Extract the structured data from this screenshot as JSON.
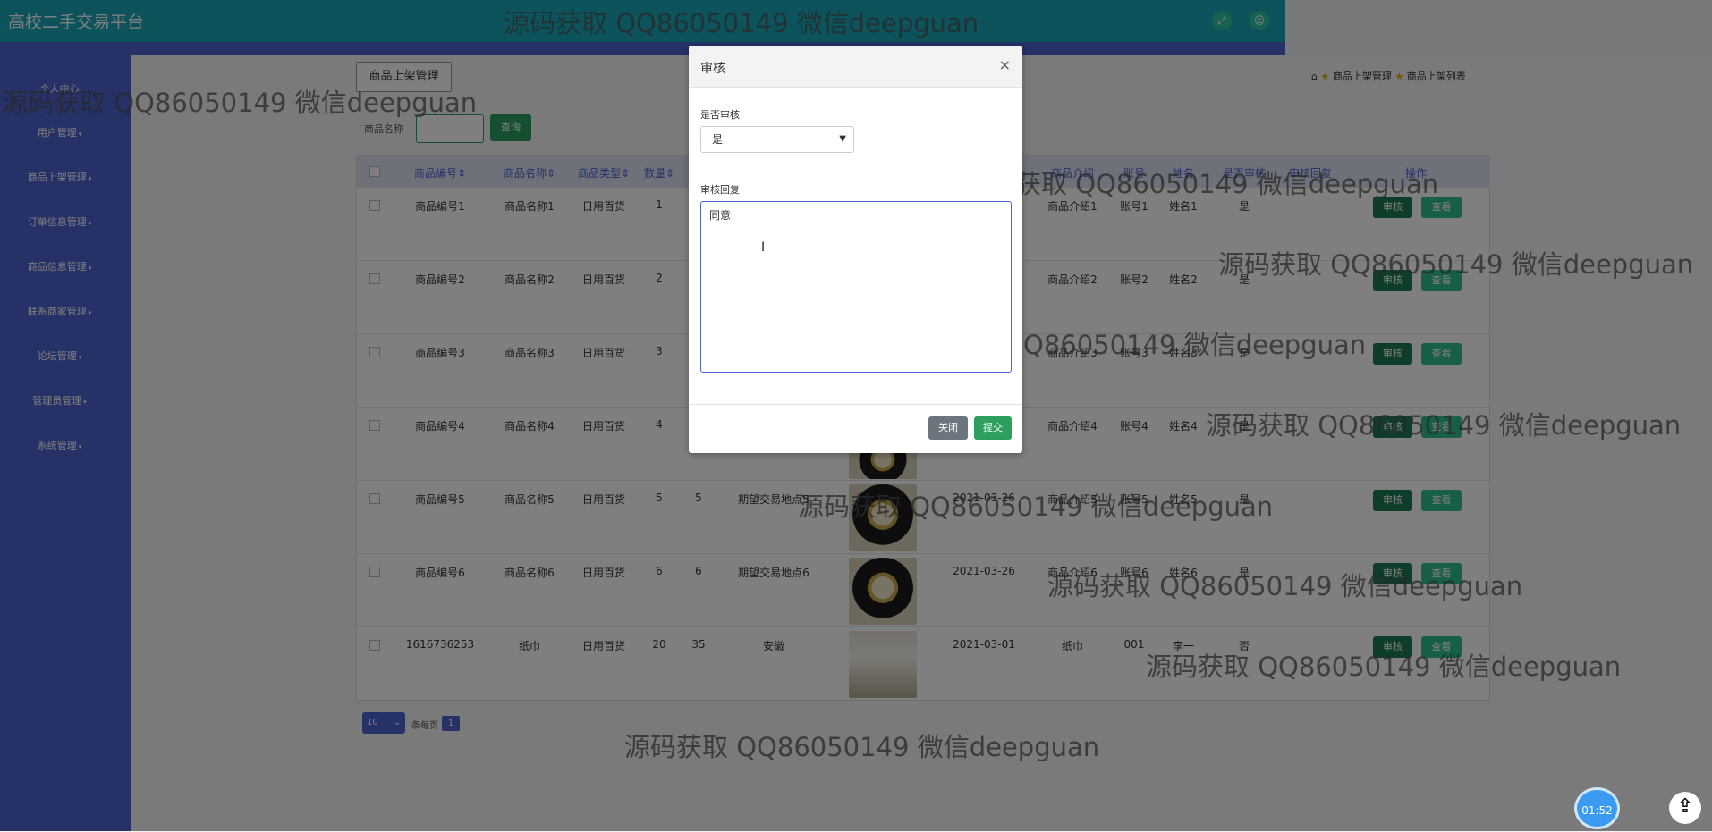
{
  "app": {
    "title": "高校二手交易平台"
  },
  "topbar": {
    "icons": [
      "fullscreen-icon",
      "user-icon"
    ]
  },
  "sidebar": {
    "items": [
      {
        "label": "个人中心"
      },
      {
        "label": "用户管理"
      },
      {
        "label": "商品上架管理"
      },
      {
        "label": "订单信息管理"
      },
      {
        "label": "商品信息管理"
      },
      {
        "label": "联系商家管理"
      },
      {
        "label": "论坛管理"
      },
      {
        "label": "管理员管理"
      },
      {
        "label": "系统管理"
      }
    ]
  },
  "page": {
    "section_button": "商品上架管理",
    "search_label": "商品名称",
    "search_value": "",
    "query_button": "查询",
    "breadcrumb": [
      "商品上架管理",
      "商品上架列表"
    ]
  },
  "table": {
    "headers": [
      "商品编号",
      "商品名称",
      "商品类型",
      "数量",
      "商品介绍",
      "账号",
      "姓名",
      "是否审核",
      "审核回复",
      "操作"
    ],
    "rows": [
      {
        "code": "商品编号1",
        "name": "商品名称1",
        "type": "日用百货",
        "qty": "1",
        "intro": "商品介绍1",
        "account": "账号1",
        "person": "姓名1",
        "audited": "是"
      },
      {
        "code": "商品编号2",
        "name": "商品名称2",
        "type": "日用百货",
        "qty": "2",
        "intro": "商品介绍2",
        "account": "账号2",
        "person": "姓名2",
        "audited": "是"
      },
      {
        "code": "商品编号3",
        "name": "商品名称3",
        "type": "日用百货",
        "qty": "3",
        "intro": "商品介绍3",
        "account": "账号3",
        "person": "姓名3",
        "audited": "是"
      },
      {
        "code": "商品编号4",
        "name": "商品名称4",
        "type": "日用百货",
        "qty": "4",
        "intro": "商品介绍4",
        "account": "账号4",
        "person": "姓名4",
        "audited": "是"
      },
      {
        "code": "商品编号5",
        "name": "商品名称5",
        "type": "日用百货",
        "qty": "5",
        "price": "5",
        "place": "期望交易地点5",
        "date": "2021-03-26",
        "intro": "商品介绍5",
        "account": "账号5",
        "person": "姓名5",
        "audited": "是"
      },
      {
        "code": "商品编号6",
        "name": "商品名称6",
        "type": "日用百货",
        "qty": "6",
        "price": "6",
        "place": "期望交易地点6",
        "date": "2021-03-26",
        "intro": "商品介绍6",
        "account": "账号6",
        "person": "姓名6",
        "audited": "是"
      },
      {
        "code": "1616736253",
        "name": "纸巾",
        "type": "日用百货",
        "qty": "20",
        "price": "35",
        "place": "安徽",
        "date": "2021-03-01",
        "intro": "纸巾",
        "account": "001",
        "person": "李一",
        "audited": "否"
      }
    ],
    "audit_button": "审核",
    "view_button": "查看"
  },
  "pager": {
    "page_size": "10",
    "per_page_text": "条每页",
    "current_page": "1"
  },
  "modal": {
    "title": "审核",
    "field1_label": "是否审核",
    "field1_value": "是",
    "field2_label": "审核回复",
    "field2_value": "同意",
    "close_button": "关闭",
    "submit_button": "提交"
  },
  "watermark": "源码获取 QQ86050149 微信deepguan",
  "timer": "01:52"
}
